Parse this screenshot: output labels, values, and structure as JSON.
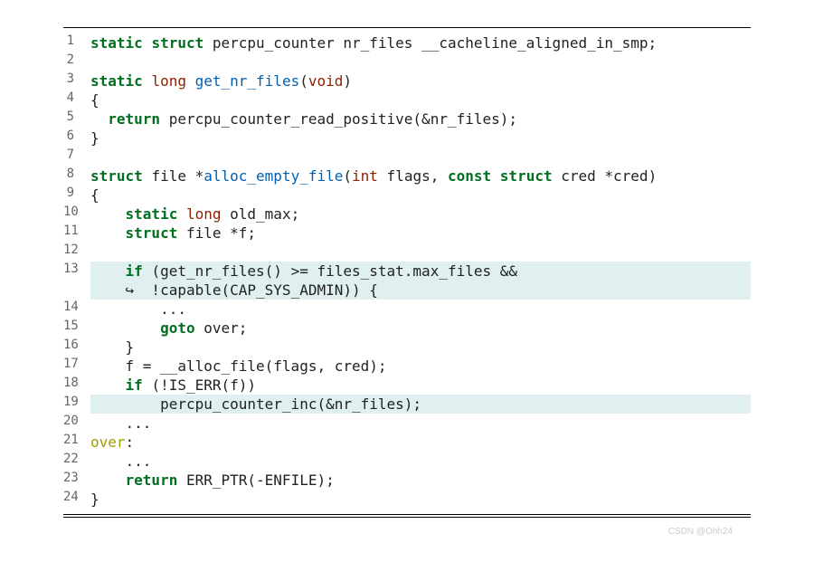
{
  "lines": [
    {
      "num": "1",
      "hl": false,
      "html": "<span class='kw-type'>static</span> <span class='kw-type'>struct</span> <span class='plain'>percpu_counter nr_files __cacheline_aligned_in_smp;</span>"
    },
    {
      "num": "2",
      "hl": false,
      "html": ""
    },
    {
      "num": "3",
      "hl": false,
      "html": "<span class='kw-type'>static</span> <span class='kw-long'>long</span> <span class='fn-name'>get_nr_files</span><span class='plain'>(</span><span class='kw-void'>void</span><span class='plain'>)</span>"
    },
    {
      "num": "4",
      "hl": false,
      "html": "<span class='plain'>{</span>"
    },
    {
      "num": "5",
      "hl": false,
      "html": "  <span class='kw-ctrl'>return</span> <span class='plain'>percpu_counter_read_positive(&amp;nr_files);</span>"
    },
    {
      "num": "6",
      "hl": false,
      "html": "<span class='plain'>}</span>"
    },
    {
      "num": "7",
      "hl": false,
      "html": ""
    },
    {
      "num": "8",
      "hl": false,
      "html": "<span class='kw-type'>struct</span> <span class='plain'>file *</span><span class='fn-name'>alloc_empty_file</span><span class='plain'>(</span><span class='kw-int'>int</span> <span class='plain'>flags, </span><span class='kw-type'>const</span> <span class='kw-type'>struct</span> <span class='plain'>cred *cred)</span>"
    },
    {
      "num": "9",
      "hl": false,
      "html": "<span class='plain'>{</span>"
    },
    {
      "num": "10",
      "hl": false,
      "html": "    <span class='kw-type'>static</span> <span class='kw-long'>long</span> <span class='plain'>old_max;</span>"
    },
    {
      "num": "11",
      "hl": false,
      "html": "    <span class='kw-type'>struct</span> <span class='plain'>file *f;</span>"
    },
    {
      "num": "12",
      "hl": false,
      "html": ""
    },
    {
      "num": "13",
      "hl": true,
      "html": "    <span class='kw-ctrl'>if</span> <span class='plain'>(get_nr_files() &gt;= files_stat.max_files &amp;&amp;</span>"
    },
    {
      "num": "",
      "hl": true,
      "html": "    <span class='plain'>↪  !capable(CAP_SYS_ADMIN)) {</span>"
    },
    {
      "num": "14",
      "hl": false,
      "html": "        <span class='plain'>...</span>"
    },
    {
      "num": "15",
      "hl": false,
      "html": "        <span class='kw-ctrl'>goto</span> <span class='plain'>over;</span>"
    },
    {
      "num": "16",
      "hl": false,
      "html": "    <span class='plain'>}</span>"
    },
    {
      "num": "17",
      "hl": false,
      "html": "    <span class='plain'>f = __alloc_file(flags, cred);</span>"
    },
    {
      "num": "18",
      "hl": false,
      "html": "    <span class='kw-ctrl'>if</span> <span class='plain'>(!IS_ERR(f))</span>"
    },
    {
      "num": "19",
      "hl": true,
      "html": "        <span class='plain'>percpu_counter_inc(&amp;nr_files);</span>"
    },
    {
      "num": "20",
      "hl": false,
      "html": "    <span class='plain'>...</span>"
    },
    {
      "num": "21",
      "hl": false,
      "html": "<span class='label'>over</span><span class='plain'>:</span>"
    },
    {
      "num": "22",
      "hl": false,
      "html": "    <span class='plain'>...</span>"
    },
    {
      "num": "23",
      "hl": false,
      "html": "    <span class='kw-ctrl'>return</span> <span class='plain'>ERR_PTR(-ENFILE);</span>"
    },
    {
      "num": "24",
      "hl": false,
      "html": "<span class='plain'>}</span>"
    }
  ],
  "watermark": "CSDN @Ohh24"
}
